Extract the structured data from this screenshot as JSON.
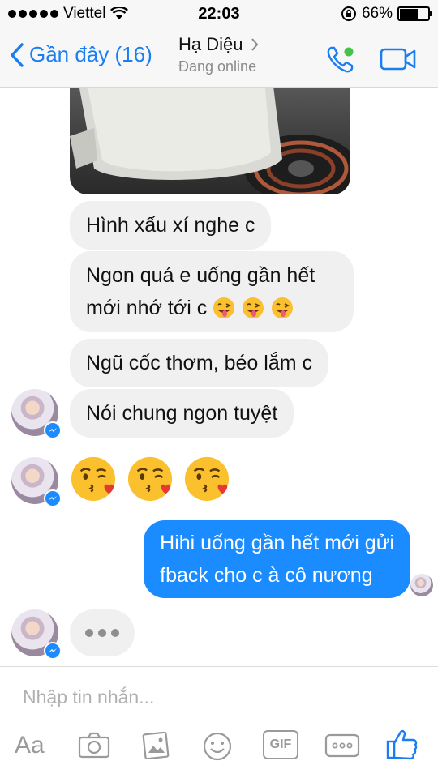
{
  "status_bar": {
    "carrier": "Viettel",
    "time": "22:03",
    "battery_percent": "66%",
    "battery_level": 0.66
  },
  "header": {
    "back_label": "Gần đây (16)",
    "contact_name": "Hạ Diệu",
    "contact_status": "Đang online",
    "accent_color": "#1a7ef3"
  },
  "messages": {
    "in_1": "Hình xấu xí nghe c",
    "in_2_line1": "Ngon quá e uống gần hết",
    "in_2_line2": "mới nhớ tới c",
    "in_3": "Ngũ cốc thơm, béo lắm c",
    "in_4": "Nói chung ngon tuyệt",
    "out_1_line1": "Hihi uống gần hết mới gửi",
    "out_1_line2": "fback cho c à cô nương",
    "outgoing_color": "#1a8cff",
    "incoming_color": "#f0f0f0"
  },
  "composer": {
    "placeholder": "Nhập tin nhắn...",
    "aa_label": "Aa",
    "gif_label": "GIF"
  },
  "icons": [
    "back-chevron-icon",
    "phone-icon",
    "video-icon",
    "messenger-badge-icon",
    "camera-icon",
    "gallery-icon",
    "sticker-icon",
    "gif-icon",
    "more-icon",
    "like-icon",
    "winking-face-icon",
    "kissing-heart-icon"
  ]
}
